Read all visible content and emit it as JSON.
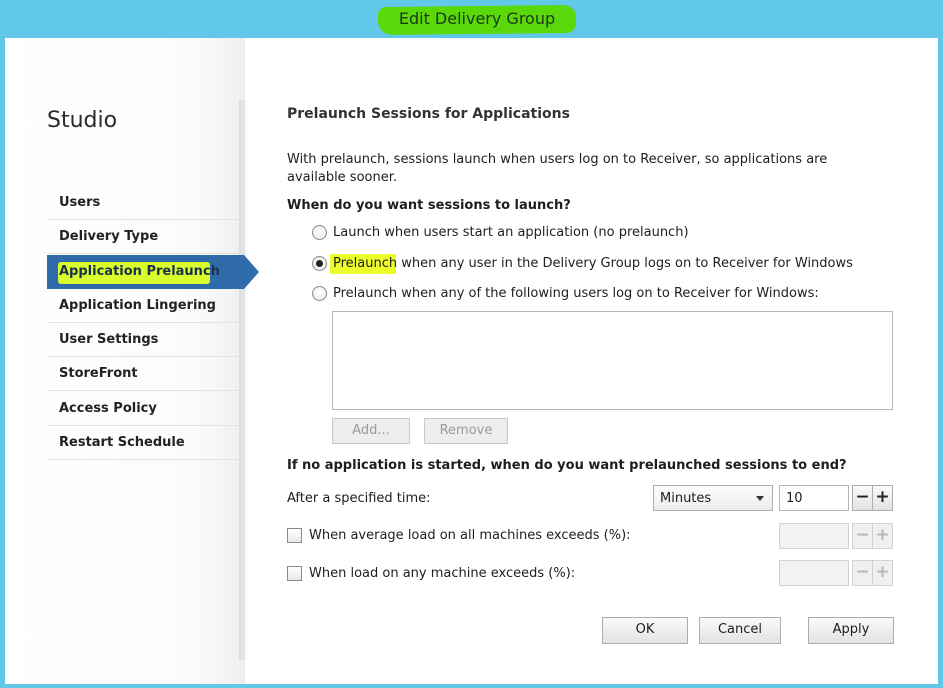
{
  "window": {
    "title": "Edit Delivery Group"
  },
  "sidebar": {
    "app_name": "Studio",
    "items": [
      {
        "label": "Users"
      },
      {
        "label": "Delivery Type"
      },
      {
        "label": "Application Prelaunch"
      },
      {
        "label": "Application Lingering"
      },
      {
        "label": "User Settings"
      },
      {
        "label": "StoreFront"
      },
      {
        "label": "Access Policy"
      },
      {
        "label": "Restart Schedule"
      }
    ],
    "active_index": 2
  },
  "content": {
    "title": "Prelaunch Sessions for Applications",
    "description": "With prelaunch, sessions launch when users log on to Receiver, so applications are available sooner.",
    "launch_question": "When do you want sessions to launch?",
    "launch_options": [
      {
        "label": "Launch when users start an application (no prelaunch)",
        "checked": false
      },
      {
        "label_highlight": "Prelaunch",
        "label_rest": " when any user in the Delivery Group logs on to Receiver for Windows",
        "checked": true
      },
      {
        "label": "Prelaunch when any of the following users log on to Receiver for Windows:",
        "checked": false
      }
    ],
    "users_list_buttons": {
      "add": "Add...",
      "remove": "Remove"
    },
    "end_question": "If no application is started, when do you want prelaunched sessions to end?",
    "after_time": {
      "label": "After a specified time:",
      "unit": "Minutes",
      "value": "10"
    },
    "load_options": [
      {
        "label": "When average load on all machines exceeds (%):",
        "checked": false,
        "value": ""
      },
      {
        "label": "When load on any machine exceeds (%):",
        "checked": false,
        "value": ""
      }
    ],
    "stepper_symbols": {
      "minus": "−",
      "plus": "+"
    }
  },
  "footer": {
    "ok": "OK",
    "cancel": "Cancel",
    "apply": "Apply"
  },
  "colors": {
    "titlebar": "#62c8ea",
    "title_highlight": "#5bd80a",
    "nav_active": "#2f6aa9",
    "text_highlight": "#ecff2b"
  }
}
